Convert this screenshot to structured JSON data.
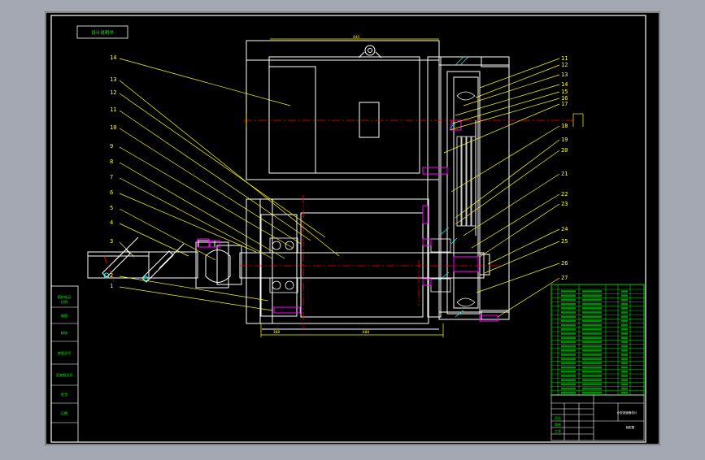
{
  "drawing": {
    "stamp_top_left": "设计说明书",
    "dim_top": "445",
    "dim_bottom_left": "300",
    "dim_bottom_mid": "600",
    "left_callouts": [
      "14",
      "13",
      "12",
      "11",
      "10",
      "9",
      "8",
      "7",
      "6",
      "5",
      "4",
      "3",
      "2",
      "1"
    ],
    "right_callouts": [
      "11",
      "12",
      "13",
      "14",
      "15",
      "16",
      "17",
      "18",
      "19",
      "20",
      "21",
      "22",
      "23",
      "24",
      "25",
      "26",
      "27"
    ]
  },
  "side_stamps": [
    "图样标记\n比例",
    "描图",
    "校核",
    "底图总号",
    "旧底图总号",
    "签字",
    "日期"
  ],
  "title_block": {
    "bottom_rows": [
      "设计",
      "审核",
      "工艺"
    ],
    "drawing_name": "小型减速器设计",
    "drawing_no": "装配图"
  },
  "colors": {
    "frame": "#ffffff",
    "body": "#ffffff",
    "callout": "#ffff00",
    "centerline": "#ff0000",
    "table": "#00ff00",
    "accent": "#00ffff",
    "fastener": "#ff00ff"
  }
}
